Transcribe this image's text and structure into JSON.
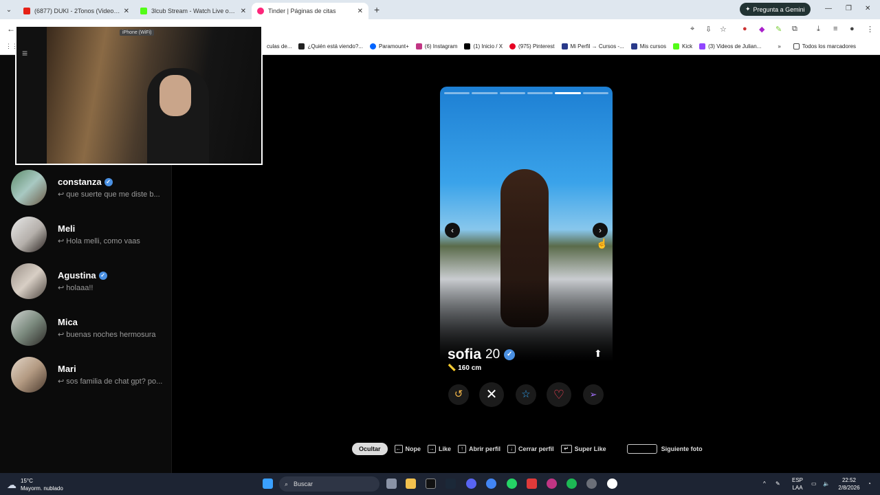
{
  "browser": {
    "tabs": [
      {
        "title": "(6877) DUKI - 2Tonos (Video Oficial)",
        "color": "#e62117",
        "active": false
      },
      {
        "title": "3lcub Stream - Watch Live on Kick",
        "color": "#53fc18",
        "active": false
      },
      {
        "title": "Tinder | Páginas de citas",
        "color": "#fd267a",
        "active": true
      }
    ],
    "new_tab": "+",
    "gemini_label": "Pregunta a Gemini",
    "bookmarks": [
      "culas de...",
      "¿Quién está viendo?...",
      "Paramount+",
      "(6) Instagram",
      "(1) Inicio / X",
      "(975) Pinterest",
      "Mi Perfil → Cursos -...",
      "Mis cursos",
      "Kick",
      "(3) Videos de Julian...",
      "»",
      "Todos los marcadores"
    ]
  },
  "webcam": {
    "label": "iPhone (WiFi)"
  },
  "matches": [
    {
      "name": "constanza",
      "verified": true,
      "message": "que suerte que me diste b..."
    },
    {
      "name": "Meli",
      "verified": false,
      "message": "Hola melli, como vaas"
    },
    {
      "name": "Agustina",
      "verified": true,
      "message": "holaaa!!"
    },
    {
      "name": "Mica",
      "verified": false,
      "message": "buenas noches hermosura"
    },
    {
      "name": "Mari",
      "verified": false,
      "message": "sos familia de chat gpt? po..."
    }
  ],
  "profile": {
    "name": "sofia",
    "age": "20",
    "height": "160 cm",
    "photo_count": 6,
    "current_photo_index": 4
  },
  "actions": {
    "rewind": "rewind-icon",
    "nope": "close-icon",
    "superlike": "star-icon",
    "like": "heart-icon",
    "boost": "send-icon"
  },
  "shortcuts": {
    "hide": "Ocultar",
    "nope": "Nope",
    "like": "Like",
    "open_profile": "Abrir perfil",
    "close_profile": "Cerrar perfil",
    "super_like": "Super Like",
    "next_photo": "Siguiente foto"
  },
  "taskbar": {
    "temp": "15°C",
    "weather": "Mayorm. nublado",
    "search": "Buscar",
    "lang1": "ESP",
    "lang2": "LAA",
    "time": "22:52",
    "date": "2/8/2026"
  },
  "colors": {
    "like": "#ff4458",
    "verified": "#4a90e2",
    "star": "#31a2f0"
  }
}
